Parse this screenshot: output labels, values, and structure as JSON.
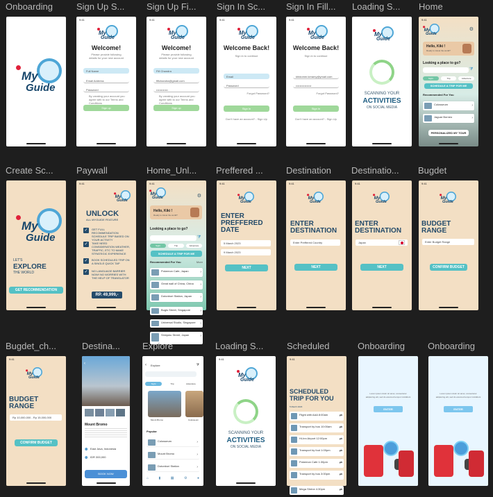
{
  "frames": [
    {
      "label": "Onboarding"
    },
    {
      "label": "Sign Up S..."
    },
    {
      "label": "Sign Up Fi..."
    },
    {
      "label": "Sign In Sc..."
    },
    {
      "label": "Sign In Fill..."
    },
    {
      "label": "Loading S..."
    },
    {
      "label": "Home"
    },
    {
      "label": "Create Sc..."
    },
    {
      "label": "Paywall"
    },
    {
      "label": "Home_Unl..."
    },
    {
      "label": "Preffered ..."
    },
    {
      "label": "Destination"
    },
    {
      "label": "Destinatio..."
    },
    {
      "label": "Bugdet"
    },
    {
      "label": "Bugdet_ch..."
    },
    {
      "label": "Destina..."
    },
    {
      "label": "Explore"
    },
    {
      "label": "Loading S..."
    },
    {
      "label": "Scheduled"
    },
    {
      "label": "Onboarding"
    },
    {
      "label": "Onboarding"
    }
  ],
  "logo": {
    "my": "My",
    "guide": "Guide"
  },
  "status_time": "9:41",
  "signup": {
    "title": "Welcome!",
    "subtitle": "Please provide following details for your new account",
    "full_name": "Full Name",
    "email": "Email Address",
    "password": "Password",
    "terms": "By creating your account you agree with to our Terms and Conditions",
    "button": "Sign up",
    "filled_name": "Fifi Chandra",
    "filled_email": "fifichandra@gmail.com",
    "filled_password": "••••••••••••"
  },
  "signin": {
    "title": "Welcome Back!",
    "subtitle": "Sign in to continue",
    "email": "Email",
    "password": "Password",
    "forgot": "Forgot Password?",
    "button": "Sign in",
    "no_account": "Don't have an account? - Sign Up",
    "filled_email": "khidomm.keramy@ymail.com",
    "filled_password": "••••••••••••••••"
  },
  "loading": {
    "top": "SCANNING YOUR",
    "big": "ACTIVITIES",
    "bottom": "ON SOCIAL MEDIA"
  },
  "home": {
    "greet": "Hello, Kiki !",
    "greet_sub": "Ready to travel the world?",
    "question": "Looking a place to go?",
    "tabs": [
      "Sight",
      "Trip",
      "Adventure"
    ],
    "schedule_btn": "SCHEDULE A TRIP FOR ME",
    "recommended": "Recommended For You",
    "items": [
      "Colosseum",
      "Jaguar Borneo"
    ],
    "personalized_btn": "PERSONALIZED MY TOUR"
  },
  "create": {
    "lets": "LET'S",
    "explore": "EXPLORE",
    "world": "THE WORLD",
    "button": "GET RECOMMENDATION"
  },
  "paywall": {
    "title": "UNLOCK",
    "subtitle": "ALL MYGUIDE FEATURE",
    "features": [
      "GET FULL RECOMMENDATION SCHEDULE TRIP BASED ON YOUR ACTIVITY",
      "TAKE NEED CONSIDERATION WEATHER, TRAFFIC, ETC TO MAKE STRATEGIC EXPERIENCE",
      "BOOK SCHEDULED TRIP ON A SINGLE QUICK TAP",
      "NO LANGUAGE BARRIER NOW! NO WORRIES WITH THE HELP OF TRANSLATOR"
    ],
    "price": "RP. 49,999,-"
  },
  "home_unlocked": {
    "items": [
      "Pokemon Cafe, Japan",
      "Great wall of China, China",
      "Dotonbori Station, Japan",
      "Bugis Street, Singapore",
      "Universal Studio, Singapore",
      "Shinjuku Street, Japan"
    ],
    "more": "More"
  },
  "preferred": {
    "title": "ENTER PREFFERED DATE",
    "from": "5 March 2023",
    "to": "9 March 2023",
    "button": "NEXT"
  },
  "destination": {
    "title": "ENTER DESTINATION",
    "placeholder": "Enter Preffered Country",
    "filled": "Japan",
    "button": "NEXT"
  },
  "budget": {
    "title": "BUDGET RANGE",
    "placeholder": "Enter Budget Range",
    "filled": "Rp 10,000,000 - Rp 15,000,000",
    "button": "CONFIRM BUDGET"
  },
  "dest_detail": {
    "name": "Mount Bromo",
    "loc": "East Java, Indonesia",
    "price": "IDR 300,000",
    "button": "BOOK NOW"
  },
  "explore": {
    "title": "Explore",
    "tabs": [
      "Sight",
      "Trip",
      "Adventure"
    ],
    "card1": "Mount Bromo",
    "card2": "Colosseum",
    "popular": "Popular",
    "items": [
      "Colosseum",
      "Mount Bromo",
      "Dotonbori Station"
    ]
  },
  "scheduled": {
    "title": "SCHEDULED TRIP FOR YOU",
    "date": "5 March 2023",
    "items": [
      "Flight with AAA 8:00am",
      "Transport by bus 10:00am",
      "Hi-Inn Airport 12:00pm",
      "Transport by foot 1:00pm",
      "Pokemon Cafe 1:30pm",
      "Transport by bus 3:00pm",
      "Mega Shrine 4:30pm"
    ]
  },
  "onboard": {
    "text": "Lorem ipsum dolor sit amet, consectetur adipiscing elit, sed do eiusmod tempor incididunt",
    "button": "ENTER"
  }
}
